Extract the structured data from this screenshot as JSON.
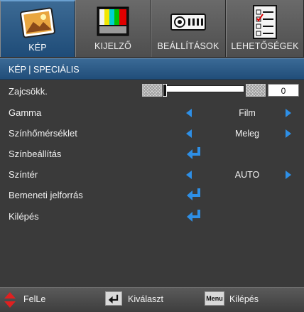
{
  "tabs": [
    {
      "label": "KÉP",
      "icon": "picture-icon",
      "active": true
    },
    {
      "label": "KIJELZŐ",
      "icon": "color-bars-icon",
      "active": false
    },
    {
      "label": "BEÁLLÍTÁSOK",
      "icon": "projector-icon",
      "active": false
    },
    {
      "label": "LEHETŐSÉGEK",
      "icon": "checklist-icon",
      "active": false
    }
  ],
  "breadcrumb": "KÉP | SPECIÁLIS",
  "menu": {
    "noise": {
      "label": "Zajcsökk.",
      "value": "0",
      "level": 0
    },
    "gamma": {
      "label": "Gamma",
      "value": "Film"
    },
    "color_temp": {
      "label": "Színhőmérséklet",
      "value": "Meleg"
    },
    "color_settings": {
      "label": "Színbeállítás"
    },
    "color_space": {
      "label": "Színtér",
      "value": "AUTO"
    },
    "input_source": {
      "label": "Bemeneti jelforrás"
    },
    "exit": {
      "label": "Kilépés"
    }
  },
  "footer": {
    "updown": "FelLe",
    "select_key_icon": "enter-key-icon",
    "select": "Kiválaszt",
    "menu_key": "Menu",
    "exit": "Kilépés"
  },
  "colors": {
    "accent": "#2e8fe6",
    "header": "#2a5a88",
    "background": "#3a3a3a"
  }
}
